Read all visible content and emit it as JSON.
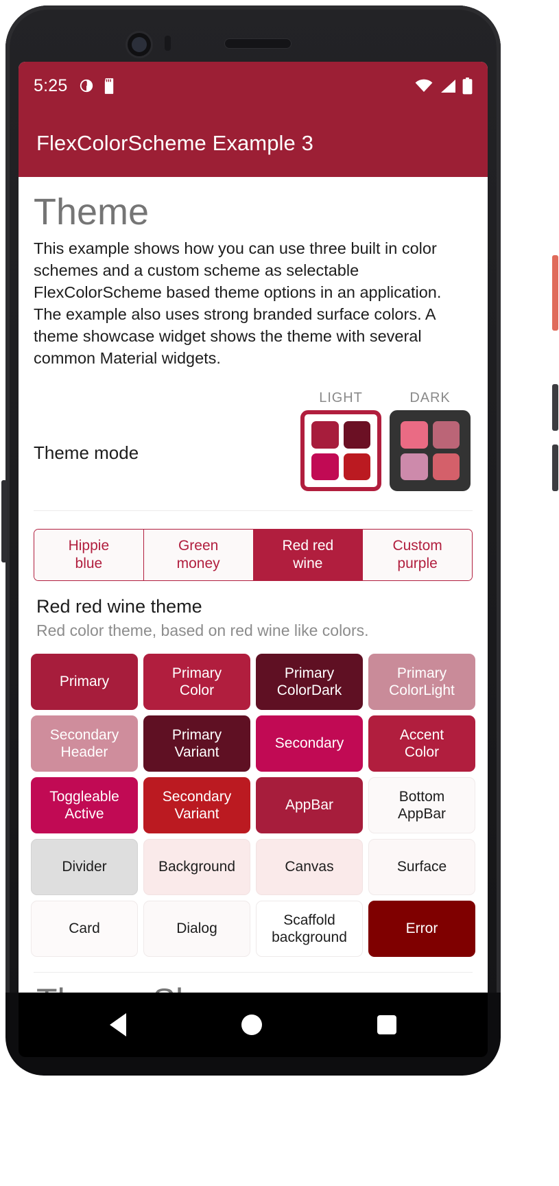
{
  "theme_colors": {
    "appbar": "#9c1f35",
    "primary": "#b11e3e",
    "primary_color": "#b11e3e",
    "primary_color_dark": "#5f1023",
    "primary_color_light": "#c98b99",
    "secondary_header": "#c98b99",
    "primary_variant": "#5f1023",
    "secondary": "#c10a54",
    "accent_color": "#b11e3e",
    "toggleable_active": "#c10a54",
    "secondary_variant": "#bb1a21",
    "appbar_color": "#9c1f35",
    "bottom_appbar": "#fcf9f9",
    "divider": "#dedede",
    "background": "#faeaea",
    "canvas": "#faeaea",
    "surface": "#fcf7f7",
    "card": "#fdfafa",
    "dialog": "#fcf9f9",
    "scaffold_background": "#ffffff",
    "error": "#7f0000"
  },
  "statusbar": {
    "time": "5:25",
    "icons": [
      "clock-face-icon",
      "sd-card-icon"
    ],
    "right_icons": [
      "wifi-icon",
      "cell-signal-icon",
      "battery-icon"
    ]
  },
  "appbar": {
    "title": "FlexColorScheme Example 3"
  },
  "theme_section": {
    "heading": "Theme",
    "description": "This example shows how you can use three built in color schemes and a custom scheme as selectable FlexColorScheme based theme options in an application. The example also uses strong branded surface colors. A theme showcase widget shows the theme with several common Material widgets."
  },
  "theme_mode": {
    "label": "Theme mode",
    "selected": "LIGHT",
    "options": [
      {
        "caption": "LIGHT",
        "selected": true,
        "swatches": [
          "#a71d3c",
          "#6b1024",
          "#c10a54",
          "#bb1a21"
        ]
      },
      {
        "caption": "DARK",
        "selected": false,
        "swatches": [
          "#ea6b84",
          "#bb6577",
          "#cd8aab",
          "#d4606a"
        ]
      }
    ]
  },
  "scheme_selector": {
    "options": [
      {
        "label": "Hippie\nblue",
        "line1": "Hippie",
        "line2": "blue",
        "selected": false
      },
      {
        "label": "Green\nmoney",
        "line1": "Green",
        "line2": "money",
        "selected": false
      },
      {
        "label": "Red red\nwine",
        "line1": "Red red",
        "line2": "wine",
        "selected": true
      },
      {
        "label": "Custom\npurple",
        "line1": "Custom",
        "line2": "purple",
        "selected": false
      }
    ]
  },
  "scheme_info": {
    "title": "Red red wine theme",
    "subtitle": "Red color theme, based on red wine like colors."
  },
  "color_swatches": [
    {
      "label": "Primary",
      "line1": "Primary",
      "line2": "",
      "bg": "#a71d3c",
      "fg": "#ffffff",
      "border": ""
    },
    {
      "label": "Primary Color",
      "line1": "Primary",
      "line2": "Color",
      "bg": "#b11e3e",
      "fg": "#ffffff",
      "border": ""
    },
    {
      "label": "Primary ColorDark",
      "line1": "Primary",
      "line2": "ColorDark",
      "bg": "#5f1023",
      "fg": "#ffffff",
      "border": ""
    },
    {
      "label": "Primary ColorLight",
      "line1": "Primary",
      "line2": "ColorLight",
      "bg": "#c98b99",
      "fg": "#ffffff",
      "border": ""
    },
    {
      "label": "Secondary Header",
      "line1": "Secondary",
      "line2": "Header",
      "bg": "#cf8d9c",
      "fg": "#ffffff",
      "border": ""
    },
    {
      "label": "Primary Variant",
      "line1": "Primary",
      "line2": "Variant",
      "bg": "#5f1023",
      "fg": "#ffffff",
      "border": ""
    },
    {
      "label": "Secondary",
      "line1": "Secondary",
      "line2": "",
      "bg": "#c10a54",
      "fg": "#ffffff",
      "border": ""
    },
    {
      "label": "Accent Color",
      "line1": "Accent",
      "line2": "Color",
      "bg": "#b11e3e",
      "fg": "#ffffff",
      "border": ""
    },
    {
      "label": "Toggleable Active",
      "line1": "Toggleable",
      "line2": "Active",
      "bg": "#c10a54",
      "fg": "#ffffff",
      "border": ""
    },
    {
      "label": "Secondary Variant",
      "line1": "Secondary",
      "line2": "Variant",
      "bg": "#bb1a21",
      "fg": "#ffffff",
      "border": ""
    },
    {
      "label": "AppBar",
      "line1": "AppBar",
      "line2": "",
      "bg": "#a71d3c",
      "fg": "#ffffff",
      "border": ""
    },
    {
      "label": "Bottom AppBar",
      "line1": "Bottom",
      "line2": "AppBar",
      "bg": "#fcf9f9",
      "fg": "#1d1d1d",
      "border": "#f0eaea"
    },
    {
      "label": "Divider",
      "line1": "Divider",
      "line2": "",
      "bg": "#dedede",
      "fg": "#1d1d1d",
      "border": "#d2d2d2"
    },
    {
      "label": "Background",
      "line1": "Background",
      "line2": "",
      "bg": "#faeaea",
      "fg": "#1d1d1d",
      "border": "#f2e2e2"
    },
    {
      "label": "Canvas",
      "line1": "Canvas",
      "line2": "",
      "bg": "#faeaea",
      "fg": "#1d1d1d",
      "border": "#f2e2e2"
    },
    {
      "label": "Surface",
      "line1": "Surface",
      "line2": "",
      "bg": "#fcf7f7",
      "fg": "#1d1d1d",
      "border": "#f0eaea"
    },
    {
      "label": "Card",
      "line1": "Card",
      "line2": "",
      "bg": "#fdfafa",
      "fg": "#1d1d1d",
      "border": "#f0eaea"
    },
    {
      "label": "Dialog",
      "line1": "Dialog",
      "line2": "",
      "bg": "#fcf9f9",
      "fg": "#1d1d1d",
      "border": "#f0eaea"
    },
    {
      "label": "Scaffold background",
      "line1": "Scaffold",
      "line2": "background",
      "bg": "#ffffff",
      "fg": "#1d1d1d",
      "border": "#eeeaea"
    },
    {
      "label": "Error",
      "line1": "Error",
      "line2": "",
      "bg": "#7f0000",
      "fg": "#ffffff",
      "border": ""
    }
  ],
  "showcase": {
    "heading": "Theme Showcase"
  },
  "navbar": {
    "items": [
      "back-button",
      "home-button",
      "recents-button"
    ]
  }
}
